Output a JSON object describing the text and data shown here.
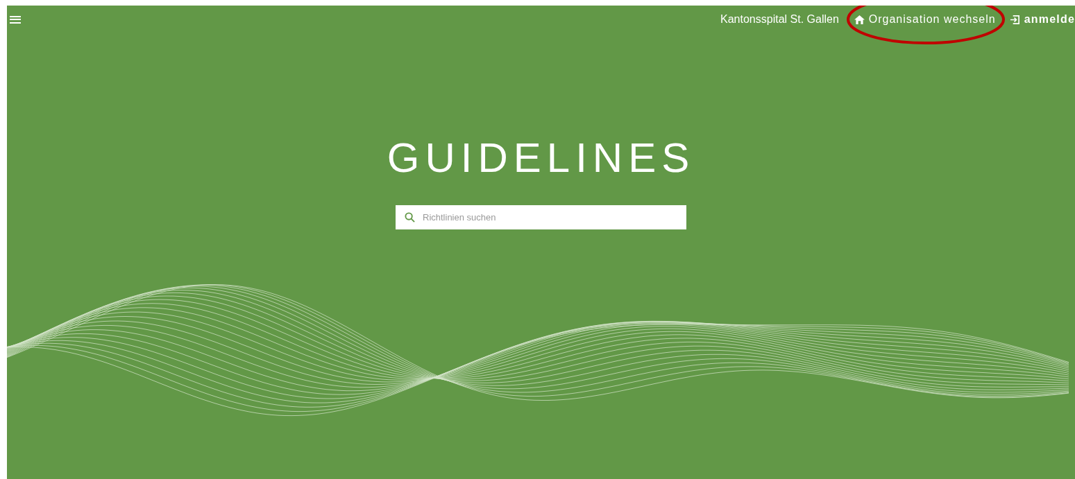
{
  "header": {
    "organization": "Kantonsspital St. Gallen",
    "links": [
      {
        "kind": "home",
        "label": "Organisation wechseln",
        "highlighted": true
      },
      {
        "kind": "login",
        "label": "anmelde",
        "highlighted": false
      }
    ]
  },
  "hero": {
    "title": "GUIDELINES",
    "search": {
      "placeholder": "Richtlinien suchen"
    }
  }
}
